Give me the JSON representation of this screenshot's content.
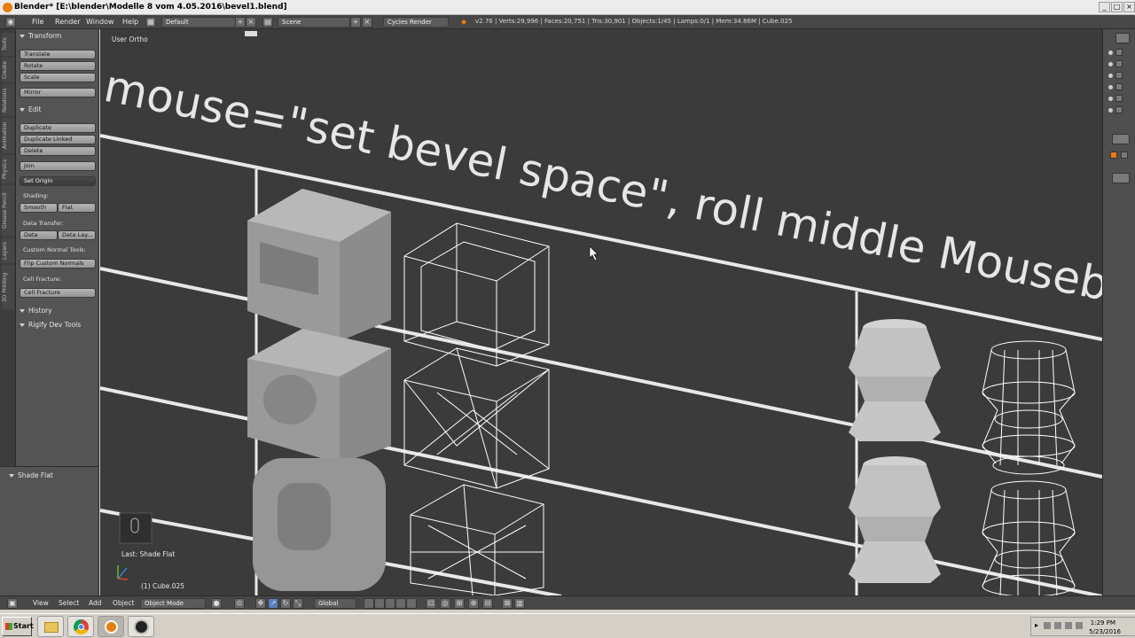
{
  "window": {
    "title": "Blender* [E:\\blender\\Modelle 8 vom 4.05.2016\\bevel1.blend]",
    "min_label": "_",
    "max_label": "□",
    "close_label": "×"
  },
  "header": {
    "menus": [
      "File",
      "Render",
      "Window",
      "Help"
    ],
    "layout": "Default",
    "scene": "Scene",
    "engine": "Cycles Render",
    "stats": "v2.76 | Verts:29,996 | Faces:20,751 | Tris:30,901 | Objects:1/45 | Lamps:0/1 | Mem:34.86M | Cube.025"
  },
  "tabs": [
    "Tools",
    "Create",
    "Relations",
    "Animation",
    "Physics",
    "Grease Pencil",
    "Layers",
    "3D Printing"
  ],
  "toolshelf": {
    "transform": {
      "title": "Transform",
      "buttons": [
        "Translate",
        "Rotate",
        "Scale"
      ],
      "mirror": "Mirror"
    },
    "edit": {
      "title": "Edit",
      "buttons": [
        "Duplicate",
        "Duplicate Linked",
        "Delete"
      ],
      "join": "Join",
      "set_origin": "Set Origin",
      "shading_label": "Shading:",
      "smooth": "Smooth",
      "flat": "Flat",
      "data_transfer_label": "Data Transfer:",
      "data": "Data",
      "data_layers": "Data Lay...",
      "custom_normal_label": "Custom Normal Tools:",
      "flip_custom": "Flip Custom Normals",
      "cell_fracture_label": "Cell Fracture:",
      "cell_fracture": "Cell Fracture"
    },
    "history": "History",
    "rigify": "Rigify Dev Tools"
  },
  "operator": {
    "title": "Shade Flat"
  },
  "viewport": {
    "view_label": "User Ortho",
    "overlay_text": "mouse=\"set bevel space\", roll middle Mousebu",
    "last_op": "Last: Shade Flat",
    "object_name": "(1) Cube.025"
  },
  "bottom_header": {
    "view": "View",
    "select": "Select",
    "add": "Add",
    "object": "Object",
    "mode": "Object Mode",
    "orientation": "Global"
  },
  "taskbar": {
    "start": "Start",
    "time": "1:29 PM",
    "date": "5/23/2016"
  },
  "colors": {
    "blender_header": "#474747",
    "toolshelf": "#545454",
    "viewport_bg": "#3b3b3b",
    "accent": "#e87d0d"
  }
}
